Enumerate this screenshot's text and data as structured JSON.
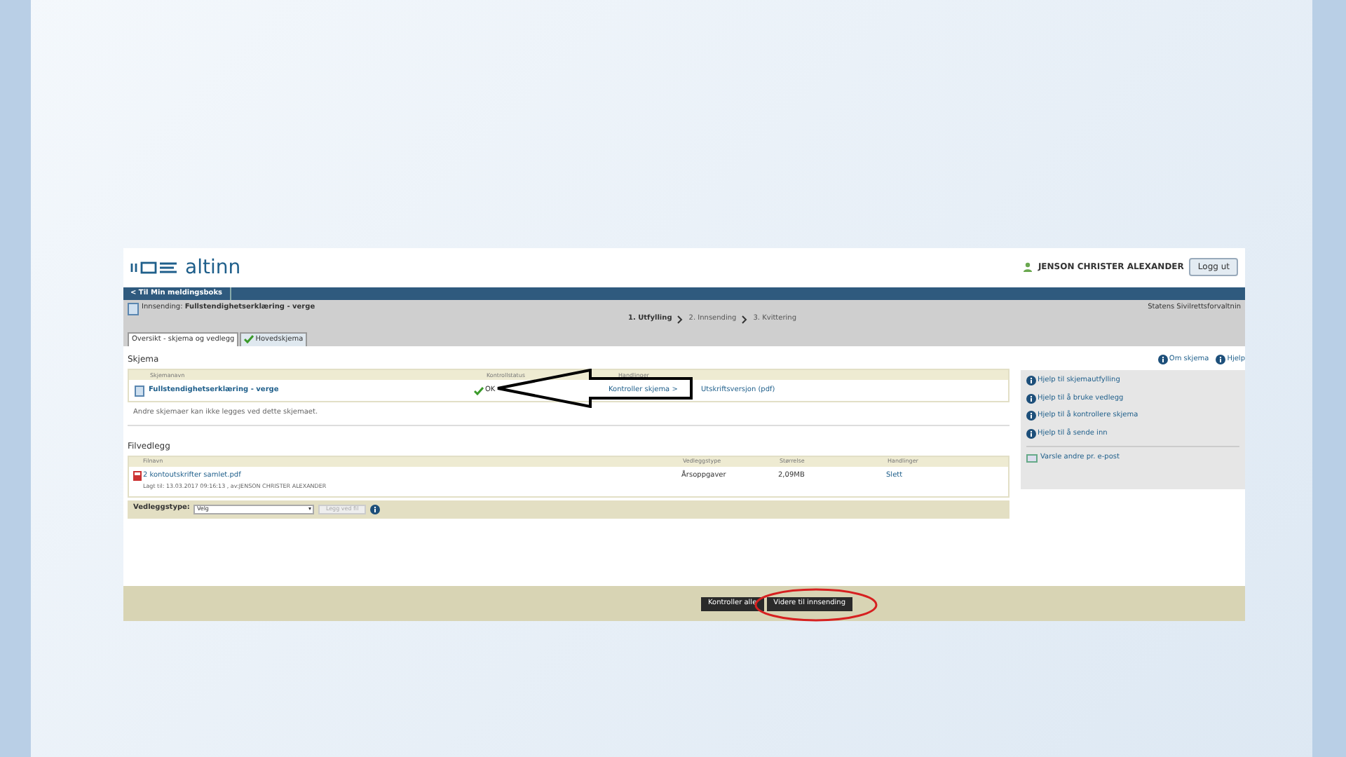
{
  "header": {
    "logo": "altinn",
    "user": "JENSON CHRISTER ALEXANDER",
    "logout": "Logg ut"
  },
  "nav": {
    "back": "< Til Min meldingsboks"
  },
  "submission": {
    "label": "Innsending:",
    "title": "Fullstendighetserklæring - verge",
    "agency": "Statens Sivilrettsforvaltnin"
  },
  "steps": [
    {
      "label": "1. Utfylling",
      "selected": true
    },
    {
      "label": "2. Innsending",
      "selected": false
    },
    {
      "label": "3. Kvittering",
      "selected": false
    }
  ],
  "tabs": [
    {
      "label": "Oversikt - skjema og vedlegg",
      "selected": true,
      "checked": false
    },
    {
      "label": "Hovedskjema",
      "selected": false,
      "checked": true
    }
  ],
  "forms": {
    "heading": "Skjema",
    "columns": [
      "Skjemanavn",
      "Kontrollstatus",
      "Handlinger"
    ],
    "rows": [
      {
        "name": "Fullstendighetserklæring - verge",
        "status": "OK",
        "ok": true,
        "actions": [
          "Kontroller skjema >",
          "Utskriftsversjon (pdf)"
        ]
      }
    ],
    "note": "Andre skjemaer kan ikke legges ved dette skjemaet."
  },
  "attachments": {
    "heading": "Filvedlegg",
    "columns": [
      "Filnavn",
      "Vedleggstype",
      "Størrelse",
      "Handlinger"
    ],
    "rows": [
      {
        "file": "2 kontoutskrifter samlet.pdf",
        "meta": "Lagt til: 13.03.2017 09:16:13 , av:JENSON CHRISTER ALEXANDER",
        "type": "Årsoppgaver",
        "size": "2,09MB",
        "action": "Slett"
      }
    ],
    "type_label": "Vedleggstype:",
    "type_value": "Velg",
    "add_button": "Legg ved fil"
  },
  "help": {
    "top": [
      "Om skjema",
      "Hjelp"
    ],
    "items": [
      "Hjelp til skjemautfylling",
      "Hjelp til å bruke vedlegg",
      "Hjelp til å kontrollere skjema",
      "Hjelp til å sende inn"
    ],
    "notify": "Varsle andre pr. e-post"
  },
  "footer": {
    "buttons": [
      {
        "label": "Kontroller alle",
        "highlighted": false
      },
      {
        "label": "Videre til innsending",
        "highlighted": true
      }
    ]
  }
}
